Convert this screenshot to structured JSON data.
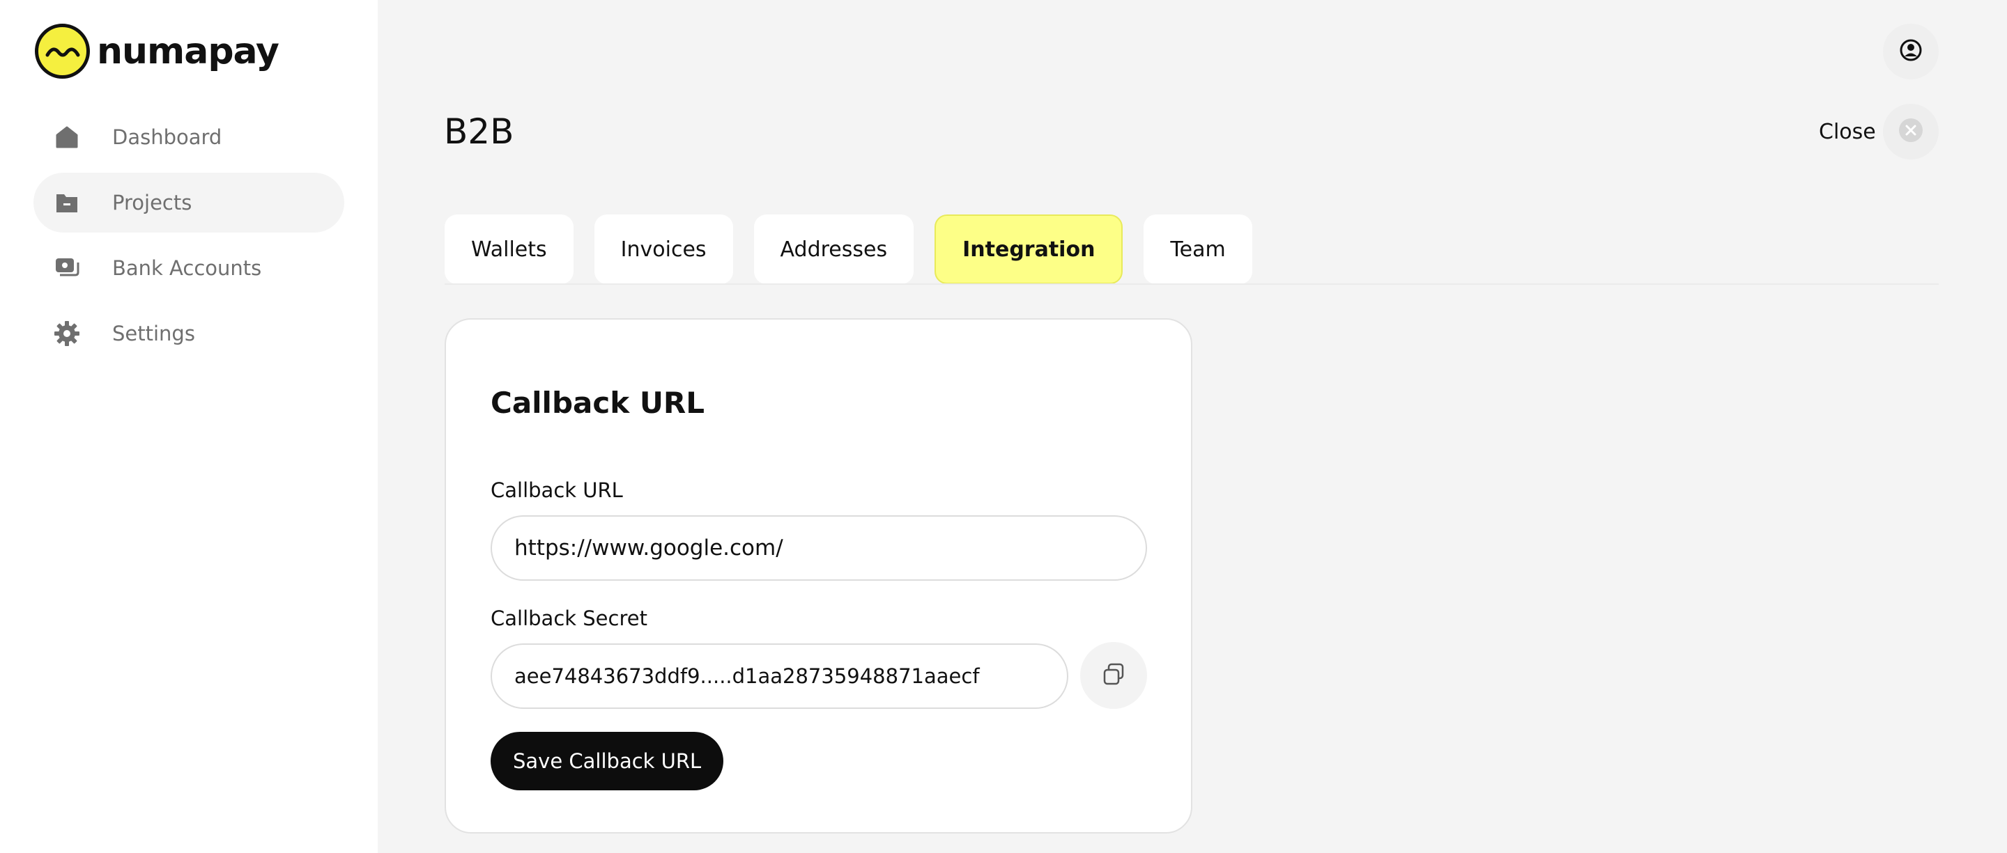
{
  "brand": {
    "name": "numapay",
    "accent": "#f5ef3f"
  },
  "sidebar": {
    "items": [
      {
        "label": "Dashboard",
        "icon": "home-icon",
        "active": false
      },
      {
        "label": "Projects",
        "icon": "folder-icon",
        "active": true
      },
      {
        "label": "Bank Accounts",
        "icon": "bank-cards-icon",
        "active": false
      },
      {
        "label": "Settings",
        "icon": "gear-icon",
        "active": false
      }
    ]
  },
  "header": {
    "title": "B2B",
    "close_label": "Close"
  },
  "tabs": [
    {
      "label": "Wallets",
      "active": false
    },
    {
      "label": "Invoices",
      "active": false
    },
    {
      "label": "Addresses",
      "active": false
    },
    {
      "label": "Integration",
      "active": true
    },
    {
      "label": "Team",
      "active": false
    }
  ],
  "card": {
    "title": "Callback URL",
    "url_label": "Callback URL",
    "url_value": "https://www.google.com/",
    "secret_label": "Callback Secret",
    "secret_value": "aee74843673ddf9.....d1aa28735948871aaecf",
    "save_label": "Save Callback URL"
  },
  "colors": {
    "active_tab_bg": "#fdff87",
    "primary_button": "#0d0d0d"
  }
}
